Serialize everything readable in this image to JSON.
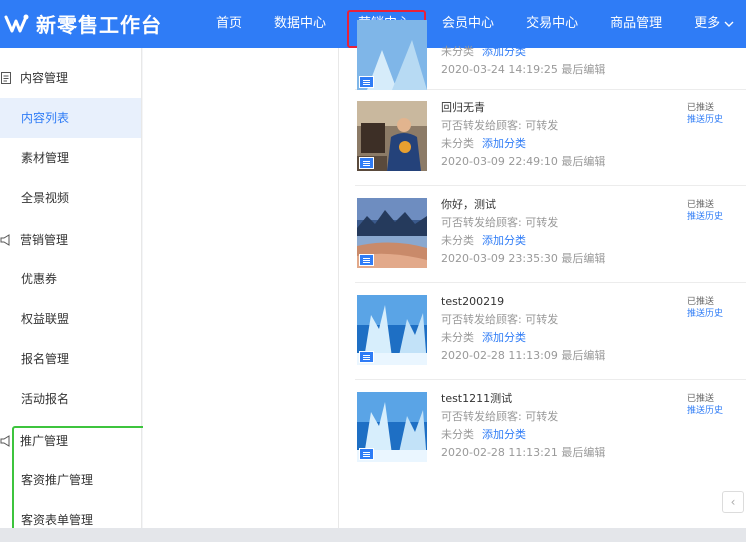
{
  "app": {
    "name": "新零售工作台"
  },
  "nav": [
    {
      "label": "首页"
    },
    {
      "label": "数据中心"
    },
    {
      "label": "营销中心"
    },
    {
      "label": "会员中心"
    },
    {
      "label": "交易中心"
    },
    {
      "label": "商品管理"
    }
  ],
  "nav_more": {
    "label": "更多"
  },
  "sidebar": {
    "groups": [
      {
        "label": "内容管理",
        "icon": "document-icon"
      },
      {
        "label": "营销管理",
        "icon": "megaphone-icon"
      },
      {
        "label": "推广管理",
        "icon": "megaphone-icon"
      }
    ],
    "items": [
      {
        "label": "内容列表"
      },
      {
        "label": "素材管理"
      },
      {
        "label": "全景视频"
      },
      {
        "label": "优惠券"
      },
      {
        "label": "权益联盟"
      },
      {
        "label": "报名管理"
      },
      {
        "label": "活动报名"
      },
      {
        "label": "客资推广管理"
      },
      {
        "label": "客资表单管理"
      }
    ]
  },
  "content": {
    "top_partial": {
      "category": "未分类",
      "add_category": "添加分类",
      "date": "2020-03-24 14:19:25 最后编辑"
    },
    "cards": [
      {
        "title": "回归无青",
        "forward": "可否转发给顾客: 可转发",
        "category": "未分类",
        "add_category": "添加分类",
        "date": "2020-03-09 22:49:10 最后编辑",
        "status": "已推送",
        "history": "推送历史"
      },
      {
        "title": "你好，测试",
        "forward": "可否转发给顾客: 可转发",
        "category": "未分类",
        "add_category": "添加分类",
        "date": "2020-03-09 23:35:30 最后编辑",
        "status": "已推送",
        "history": "推送历史"
      },
      {
        "title": "test200219",
        "forward": "可否转发给顾客: 可转发",
        "category": "未分类",
        "add_category": "添加分类",
        "date": "2020-02-28 11:13:09 最后编辑",
        "status": "已推送",
        "history": "推送历史"
      },
      {
        "title": "test1211测试",
        "forward": "可否转发给顾客: 可转发",
        "category": "未分类",
        "add_category": "添加分类",
        "date": "2020-02-28 11:13:21 最后编辑",
        "status": "已推送",
        "history": "推送历史"
      }
    ]
  },
  "pagination": {
    "prev_label": "‹"
  },
  "colors": {
    "primary": "#2f7cf6",
    "highlight_red": "#e8213a",
    "highlight_green": "#3dc43d"
  }
}
